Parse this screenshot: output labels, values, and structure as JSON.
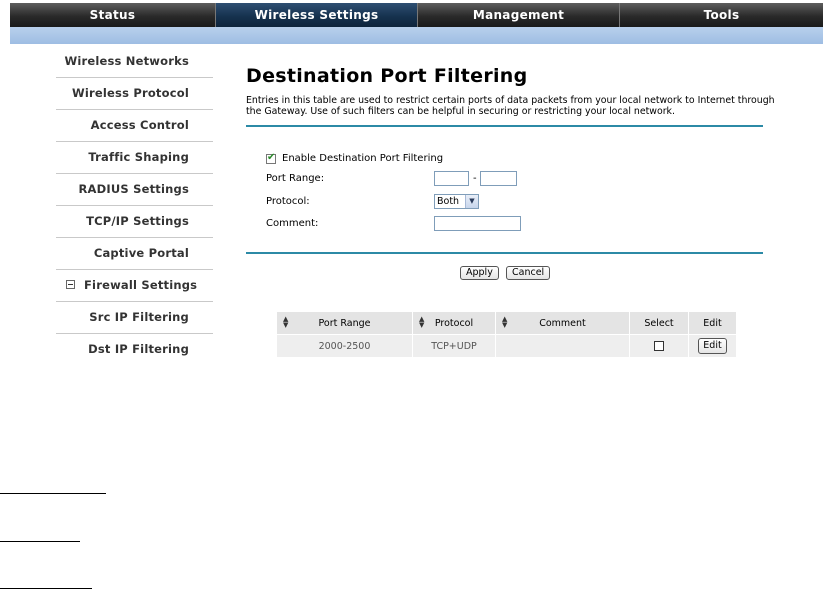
{
  "nav": {
    "tabs": [
      {
        "label": "Status"
      },
      {
        "label": "Wireless Settings"
      },
      {
        "label": "Management"
      },
      {
        "label": "Tools"
      }
    ],
    "active_tab": "Wireless Settings"
  },
  "sidebar": {
    "items": [
      {
        "label": "Wireless Networks"
      },
      {
        "label": "Wireless Protocol"
      },
      {
        "label": "Access Control"
      },
      {
        "label": "Traffic Shaping"
      },
      {
        "label": "RADIUS Settings"
      },
      {
        "label": "TCP/IP Settings"
      },
      {
        "label": "Captive Portal"
      },
      {
        "label": "Firewall Settings"
      },
      {
        "label": "Src IP Filtering"
      },
      {
        "label": "Dst IP Filtering"
      }
    ]
  },
  "main": {
    "title": "Destination Port Filtering",
    "description": "Entries in this table are used to restrict certain ports of data packets from your local network to Internet through the Gateway. Use of such filters can be helpful in securing or restricting your local network.",
    "form": {
      "enable_label": "Enable Destination Port Filtering",
      "enable_checked": true,
      "port_range_label": "Port Range:",
      "port_from_value": "",
      "port_separator": "-",
      "port_to_value": "",
      "protocol_label": "Protocol:",
      "protocol_value": "Both",
      "comment_label": "Comment:",
      "comment_value": ""
    },
    "buttons": {
      "apply": "Apply",
      "cancel": "Cancel"
    },
    "table": {
      "headers": [
        "Port Range",
        "Protocol",
        "Comment",
        "Select",
        "Edit"
      ],
      "rows": [
        {
          "port_range": "2000-2500",
          "protocol": "TCP+UDP",
          "comment": "",
          "select": false,
          "edit": "Edit"
        }
      ]
    }
  },
  "colors": {
    "nav_bg": "#2a2a2a",
    "nav_active": "#16324f",
    "blue_bar": "#a9c6e8",
    "divider": "#2c8aa6",
    "check": "#2a8a2a"
  }
}
